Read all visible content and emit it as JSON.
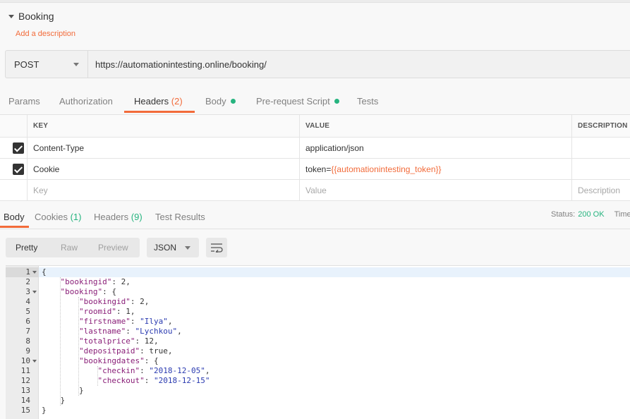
{
  "request": {
    "name": "Booking",
    "add_description": "Add a description",
    "method": "POST",
    "url": "https://automationintesting.online/booking/"
  },
  "request_tabs": [
    {
      "label": "Params",
      "count": "",
      "dot": false
    },
    {
      "label": "Authorization",
      "count": "",
      "dot": false
    },
    {
      "label": "Headers",
      "count": "(2)",
      "dot": false,
      "active": true
    },
    {
      "label": "Body",
      "count": "",
      "dot": true
    },
    {
      "label": "Pre-request Script",
      "count": "",
      "dot": true
    },
    {
      "label": "Tests",
      "count": "",
      "dot": false
    }
  ],
  "headers_table": {
    "columns": [
      "KEY",
      "VALUE",
      "DESCRIPTION"
    ],
    "rows": [
      {
        "checked": true,
        "key": "Content-Type",
        "value": "application/json",
        "description": ""
      },
      {
        "checked": true,
        "key": "Cookie",
        "value_prefix": "token=",
        "value_var": "{{automationintesting_token}}",
        "description": ""
      }
    ],
    "placeholder": {
      "key": "Key",
      "value": "Value",
      "description": "Description"
    }
  },
  "response_tabs": [
    {
      "label": "Body",
      "count": "",
      "active": true
    },
    {
      "label": "Cookies",
      "count": "(1)"
    },
    {
      "label": "Headers",
      "count": "(9)"
    },
    {
      "label": "Test Results",
      "count": ""
    }
  ],
  "status": {
    "label": "Status:",
    "value": "200 OK",
    "time_label": "Time"
  },
  "body_formats": {
    "options": [
      "Pretty",
      "Raw",
      "Preview"
    ],
    "active": "Pretty",
    "language": "JSON"
  },
  "response_lines": [
    {
      "n": "1",
      "fold": true
    },
    {
      "n": "2"
    },
    {
      "n": "3",
      "fold": true
    },
    {
      "n": "4"
    },
    {
      "n": "5"
    },
    {
      "n": "6"
    },
    {
      "n": "7"
    },
    {
      "n": "8"
    },
    {
      "n": "9"
    },
    {
      "n": "10",
      "fold": true
    },
    {
      "n": "11"
    },
    {
      "n": "12"
    },
    {
      "n": "13"
    },
    {
      "n": "14"
    },
    {
      "n": "15"
    }
  ],
  "response_body": {
    "bookingid": 2,
    "booking": {
      "bookingid": 2,
      "roomid": 1,
      "firstname": "Ilya",
      "lastname": "Lychkou",
      "totalprice": 12,
      "depositpaid": true,
      "bookingdates": {
        "checkin": "2018-12-05",
        "checkout": "2018-12-15"
      }
    }
  },
  "colors": {
    "accent": "#f26b3a",
    "success": "#26b47f",
    "json_key": "#8a1f78",
    "json_string": "#2a3ab0"
  },
  "icons": {
    "collapse": "caret-down-icon",
    "wrap": "wrap-lines-icon",
    "checkbox": "checkbox-checked-icon"
  }
}
